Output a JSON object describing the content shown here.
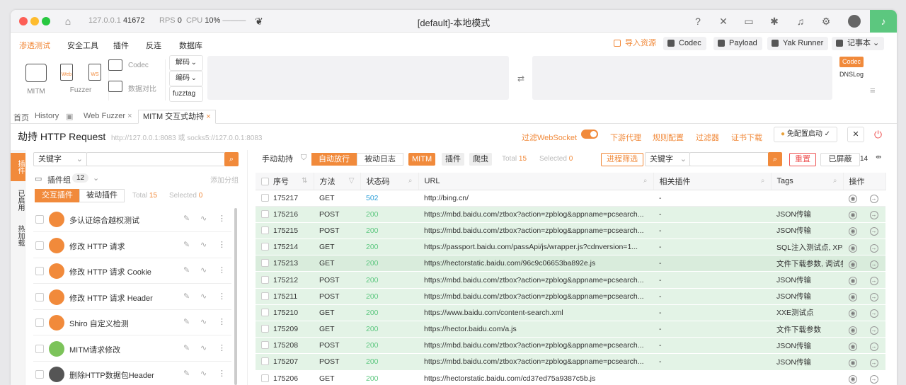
{
  "titlebar": {
    "host": "127.0.0.1",
    "port": "41672",
    "rps_label": "RPS",
    "rps_value": "0",
    "cpu_label": "CPU",
    "cpu_value": "10%",
    "title": "[default]-本地模式"
  },
  "menu": {
    "items": [
      "渗透测试",
      "安全工具",
      "插件",
      "反连",
      "数据库"
    ],
    "right": [
      "导入资源",
      "Codec",
      "Payload",
      "Yak Runner",
      "记事本"
    ]
  },
  "tools": {
    "mitm": "MITM",
    "fuzzer": "Fuzzer",
    "fuzzer_web": "Web",
    "fuzzer_ws": "WS",
    "codec": "Codec",
    "compare": "数据对比",
    "decode": "解码",
    "encode": "编码",
    "fuzztag": "fuzztag",
    "side_codec": "Codec",
    "side_dnslog": "DNSLog"
  },
  "tabs": {
    "home": "首页",
    "history": "History",
    "webfuzzer": "Web Fuzzer",
    "mitm": "MITM 交互式劫持"
  },
  "hijack": {
    "title": "劫持 HTTP Request",
    "subtitle": "http://127.0.0.1:8083 或 socks5://127.0.0.1:8083",
    "filter_ws": "过滤WebSocket",
    "downstream": "下游代理",
    "rules": "规则配置",
    "filter": "过滤器",
    "cert": "证书下载",
    "free_cfg": "免配置启动"
  },
  "rail": [
    "插件",
    "已启用",
    "热加载"
  ],
  "left": {
    "keyword": "关键字",
    "plugin_group": "插件组",
    "group_count": "12",
    "add_group": "添加分组",
    "seg_interactive": "交互插件",
    "seg_passive": "被动插件",
    "total_label": "Total",
    "total": "15",
    "selected_label": "Selected",
    "selected": "0",
    "plugins": [
      "多认证综合越权测试",
      "修改 HTTP 请求",
      "修改 HTTP 请求 Cookie",
      "修改 HTTP 请求 Header",
      "Shiro 自定义检测",
      "MITM请求修改",
      "删除HTTP数据包Header"
    ]
  },
  "right": {
    "manual": "手动劫持",
    "auto": "自动放行",
    "passive_log": "被动日志",
    "tag_mitm": "MITM",
    "tag_plugin": "插件",
    "tag_crawler": "爬虫",
    "total_label": "Total",
    "total": "15",
    "selected_label": "Selected",
    "selected": "0",
    "process_filter": "进程筛选",
    "keyword": "关键字",
    "reset": "重置",
    "fullscreen": "已屏蔽条...",
    "fullscreen_count": "14"
  },
  "table": {
    "headers": [
      "序号",
      "方法",
      "状态码",
      "URL",
      "相关插件",
      "Tags",
      "操作"
    ],
    "rows": [
      {
        "id": "175217",
        "method": "GET",
        "status": "502",
        "url": "http://bing.cn/",
        "plugin": "-",
        "tags": ""
      },
      {
        "id": "175216",
        "method": "POST",
        "status": "200",
        "url": "https://mbd.baidu.com/ztbox?action=zpblog&appname=pcsearch...",
        "plugin": "-",
        "tags": "JSON传输"
      },
      {
        "id": "175215",
        "method": "POST",
        "status": "200",
        "url": "https://mbd.baidu.com/ztbox?action=zpblog&appname=pcsearch...",
        "plugin": "-",
        "tags": "JSON传输"
      },
      {
        "id": "175214",
        "method": "GET",
        "status": "200",
        "url": "https://passport.baidu.com/passApi/js/wrapper.js?cdnversion=1...",
        "plugin": "-",
        "tags": "SQL注入测试点, XPa..."
      },
      {
        "id": "175213",
        "method": "GET",
        "status": "200",
        "url": "https://hectorstatic.baidu.com/96c9c06653ba892e.js",
        "plugin": "-",
        "tags": "文件下载参数, 调试参..."
      },
      {
        "id": "175212",
        "method": "POST",
        "status": "200",
        "url": "https://mbd.baidu.com/ztbox?action=zpblog&appname=pcsearch...",
        "plugin": "-",
        "tags": "JSON传输"
      },
      {
        "id": "175211",
        "method": "POST",
        "status": "200",
        "url": "https://mbd.baidu.com/ztbox?action=zpblog&appname=pcsearch...",
        "plugin": "-",
        "tags": "JSON传输"
      },
      {
        "id": "175210",
        "method": "GET",
        "status": "200",
        "url": "https://www.baidu.com/content-search.xml",
        "plugin": "-",
        "tags": "XXE测试点"
      },
      {
        "id": "175209",
        "method": "GET",
        "status": "200",
        "url": "https://hector.baidu.com/a.js",
        "plugin": "-",
        "tags": "文件下载参数"
      },
      {
        "id": "175208",
        "method": "POST",
        "status": "200",
        "url": "https://mbd.baidu.com/ztbox?action=zpblog&appname=pcsearch...",
        "plugin": "-",
        "tags": "JSON传输"
      },
      {
        "id": "175207",
        "method": "POST",
        "status": "200",
        "url": "https://mbd.baidu.com/ztbox?action=zpblog&appname=pcsearch...",
        "plugin": "-",
        "tags": "JSON传输"
      },
      {
        "id": "175206",
        "method": "GET",
        "status": "200",
        "url": "https://hectorstatic.baidu.com/cd37ed75a9387c5b.js",
        "plugin": "",
        "tags": ""
      }
    ]
  },
  "colors": {
    "accent": "#f18a3b",
    "green": "#5cc77f",
    "row_highlight": "#e3f3e6"
  }
}
